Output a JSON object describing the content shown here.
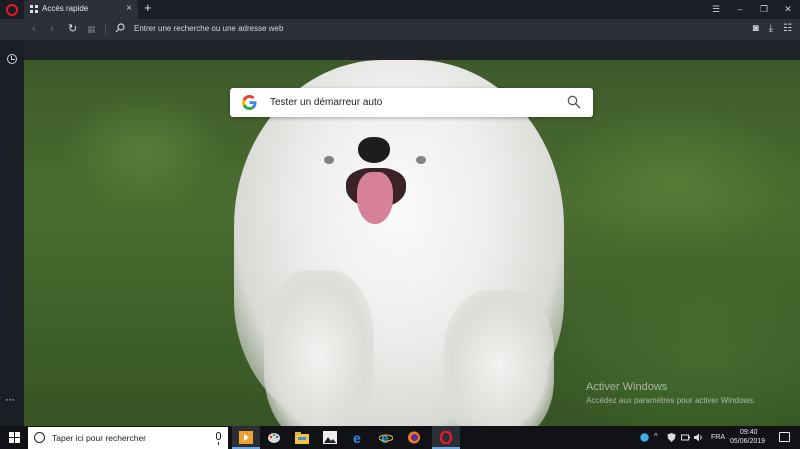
{
  "browser": {
    "tab": {
      "title": "Accès rapide"
    },
    "new_tab_glyph": "+",
    "window_controls": [
      "☰",
      "–",
      "❐",
      "✕"
    ],
    "address_bar": {
      "placeholder": "Entrer une recherche ou une adresse web"
    },
    "icons": [
      "back-icon",
      "forward-icon",
      "reload-icon",
      "tabs-grid-icon",
      "search-icon",
      "camera-icon",
      "download-icon",
      "settings-icon"
    ]
  },
  "sidebar": {
    "items": [
      {
        "icon": "history-icon"
      }
    ],
    "more_label": "···"
  },
  "speed_dial": {
    "search": {
      "placeholder": "Tester un démarreur auto",
      "engine_icon": "google-icon"
    }
  },
  "watermark": {
    "line1": "Activer Windows",
    "line2": "Accédez aux paramètres pour activer Windows."
  },
  "taskbar": {
    "search_placeholder": "Taper ici pour rechercher",
    "apps": [
      "media-player-icon",
      "paint-icon",
      "file-explorer-icon",
      "photos-icon",
      "edge-icon",
      "internet-explorer-icon",
      "firefox-icon",
      "opera-icon"
    ],
    "language": "FRA",
    "time": "09:40",
    "date": "05/06/2019"
  },
  "colors": {
    "opera_red": "#e8182c",
    "taskbar_bg": "#101215",
    "active_indicator": "#6aa7e0"
  }
}
